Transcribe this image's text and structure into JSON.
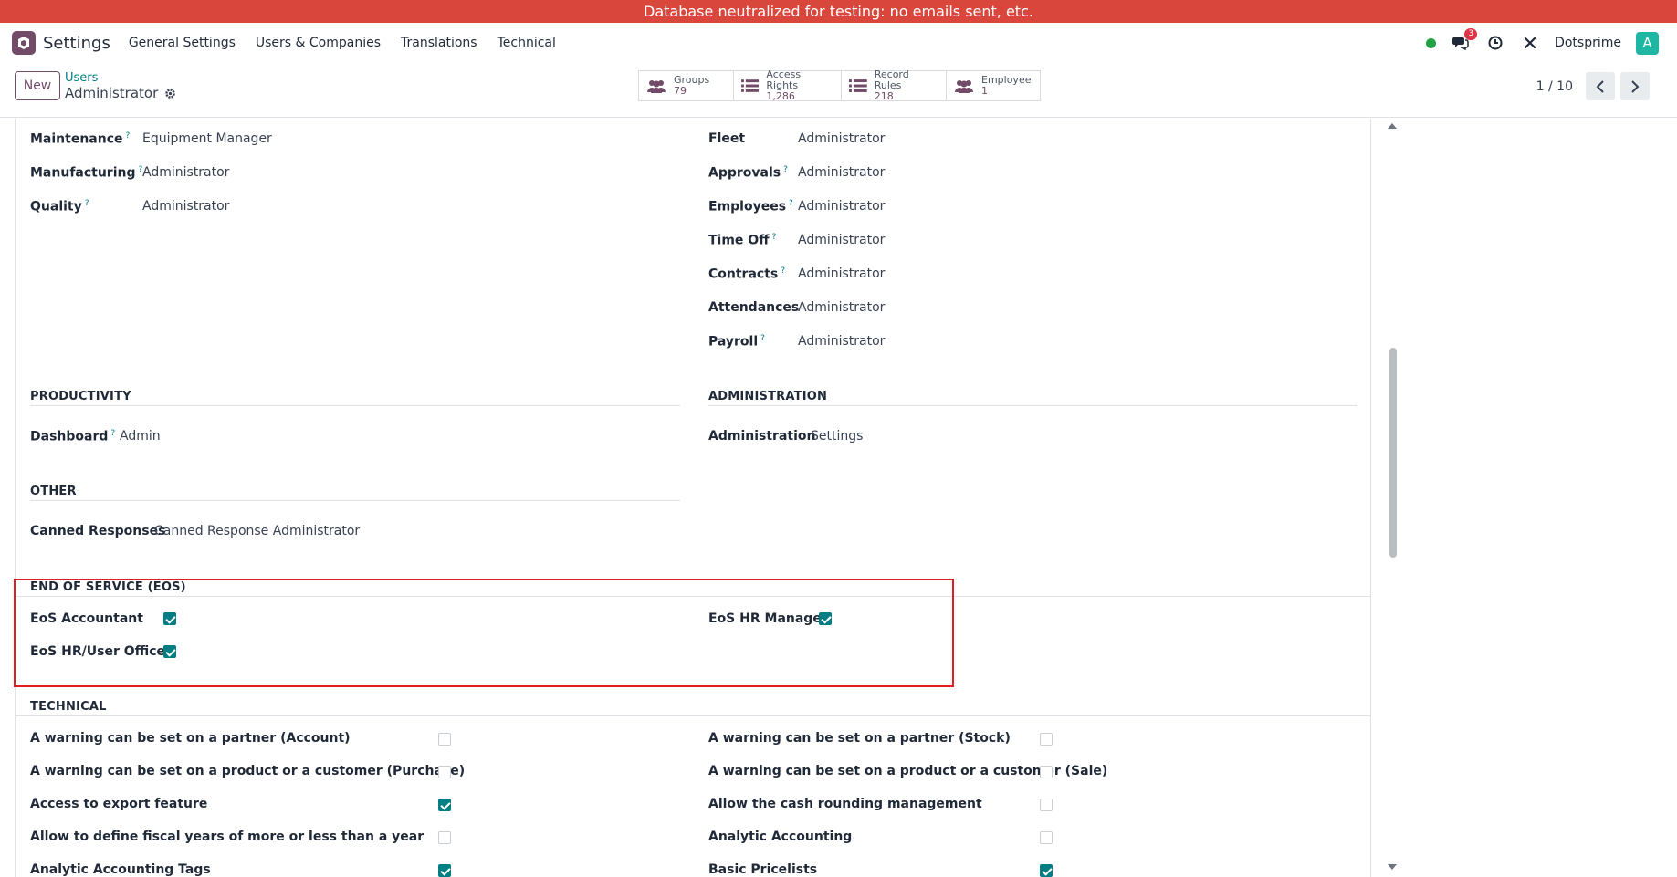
{
  "banner": {
    "text": "Database neutralized for testing: no emails sent, etc."
  },
  "navbar": {
    "app_name": "Settings",
    "menu": [
      "General Settings",
      "Users & Companies",
      "Translations",
      "Technical"
    ],
    "messages_count": "3",
    "company": "Dotsprime",
    "avatar_letter": "A"
  },
  "control": {
    "new_label": "New",
    "breadcrumb_parent": "Users",
    "breadcrumb_current": "Administrator",
    "smart_buttons": [
      {
        "label": "Groups",
        "value": "79",
        "icon": "users-icon"
      },
      {
        "label": "Access Rights",
        "value": "1,286",
        "icon": "list-icon"
      },
      {
        "label": "Record Rules",
        "value": "218",
        "icon": "list-icon"
      },
      {
        "label": "Employee",
        "value": "1",
        "icon": "users-icon"
      }
    ],
    "pager": "1 / 10"
  },
  "fields_left": [
    {
      "label": "Maintenance",
      "help": "?",
      "value": "Equipment Manager"
    },
    {
      "label": "Manufacturing",
      "help": "?",
      "value": "Administrator"
    },
    {
      "label": "Quality",
      "help": "?",
      "value": "Administrator"
    }
  ],
  "fields_right": [
    {
      "label": "Fleet",
      "help": "",
      "value": "Administrator"
    },
    {
      "label": "Approvals",
      "help": "?",
      "value": "Administrator"
    },
    {
      "label": "Employees",
      "help": "?",
      "value": "Administrator"
    },
    {
      "label": "Time Off",
      "help": "?",
      "value": "Administrator"
    },
    {
      "label": "Contracts",
      "help": "?",
      "value": "Administrator"
    },
    {
      "label": "Attendances",
      "help": "",
      "value": "Administrator"
    },
    {
      "label": "Payroll",
      "help": "?",
      "value": "Administrator"
    }
  ],
  "productivity": {
    "title": "PRODUCTIVITY",
    "label": "Dashboard",
    "help": "?",
    "value": "Admin"
  },
  "administration": {
    "title": "ADMINISTRATION",
    "label": "Administration",
    "value": "Settings"
  },
  "other": {
    "title": "OTHER",
    "label": "Canned Responses",
    "value": "Canned Response Administrator"
  },
  "eos": {
    "title": "END OF SERVICE (EOS)",
    "items": [
      {
        "label": "EoS Accountant",
        "checked": true
      },
      {
        "label": "EoS HR Manager",
        "checked": true
      },
      {
        "label": "EoS HR/User Officer",
        "checked": true
      }
    ]
  },
  "technical": {
    "title": "TECHNICAL",
    "left": [
      {
        "label": "A warning can be set on a partner (Account)",
        "checked": false
      },
      {
        "label": "A warning can be set on a product or a customer (Purchase)",
        "checked": false
      },
      {
        "label": "Access to export feature",
        "checked": true
      },
      {
        "label": "Allow to define fiscal years of more or less than a year",
        "checked": false
      },
      {
        "label": "Analytic Accounting Tags",
        "checked": true
      }
    ],
    "right": [
      {
        "label": "A warning can be set on a partner (Stock)",
        "checked": false
      },
      {
        "label": "A warning can be set on a product or a customer (Sale)",
        "checked": false
      },
      {
        "label": "Allow the cash rounding management",
        "checked": false
      },
      {
        "label": "Analytic Accounting",
        "checked": false
      },
      {
        "label": "Basic Pricelists",
        "checked": true
      }
    ]
  }
}
